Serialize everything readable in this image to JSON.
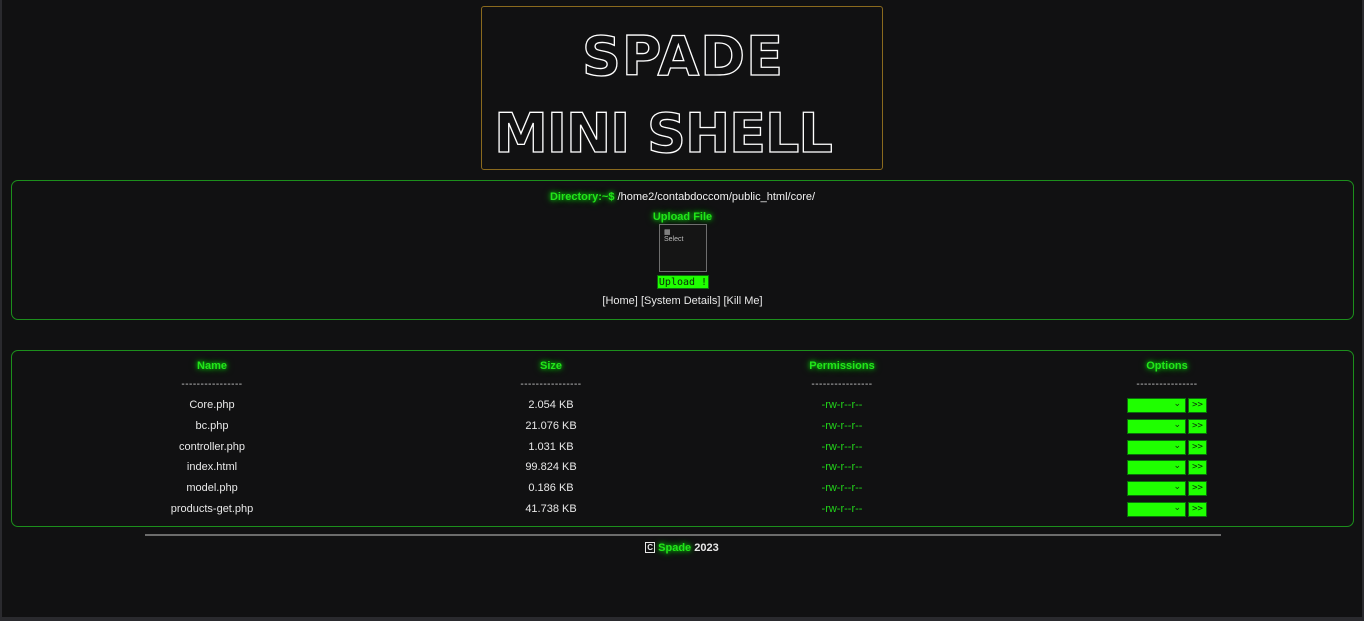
{
  "banner": {
    "line1": "SPADE",
    "line2": "MINI SHELL"
  },
  "directory": {
    "prompt": "Directory:~$",
    "path": "/home2/contabdoccom/public_html/core/"
  },
  "upload": {
    "title": "Upload File",
    "file_icon_label": "Select",
    "button_label": "Upload !"
  },
  "nav": {
    "home": "[Home]",
    "system": "[System Details]",
    "kill": "[Kill Me]"
  },
  "table": {
    "headers": {
      "name": "Name",
      "size": "Size",
      "perms": "Permissions",
      "options": "Options"
    },
    "dash": "----------------",
    "go_label": ">>",
    "rows": [
      {
        "name": "Core.php",
        "size": "2.054 KB",
        "perms": "-rw-r--r--"
      },
      {
        "name": "bc.php",
        "size": "21.076 KB",
        "perms": "-rw-r--r--"
      },
      {
        "name": "controller.php",
        "size": "1.031 KB",
        "perms": "-rw-r--r--"
      },
      {
        "name": "index.html",
        "size": "99.824 KB",
        "perms": "-rw-r--r--"
      },
      {
        "name": "model.php",
        "size": "0.186 KB",
        "perms": "-rw-r--r--"
      },
      {
        "name": "products-get.php",
        "size": "41.738 KB",
        "perms": "-rw-r--r--"
      }
    ]
  },
  "footer": {
    "copyright_symbol": "C",
    "brand": "Spade",
    "year": "2023"
  },
  "colors": {
    "accent_green": "#1fff00",
    "border_green": "#1c8f1c",
    "banner_border": "#8a6a1e",
    "background": "#111112"
  }
}
